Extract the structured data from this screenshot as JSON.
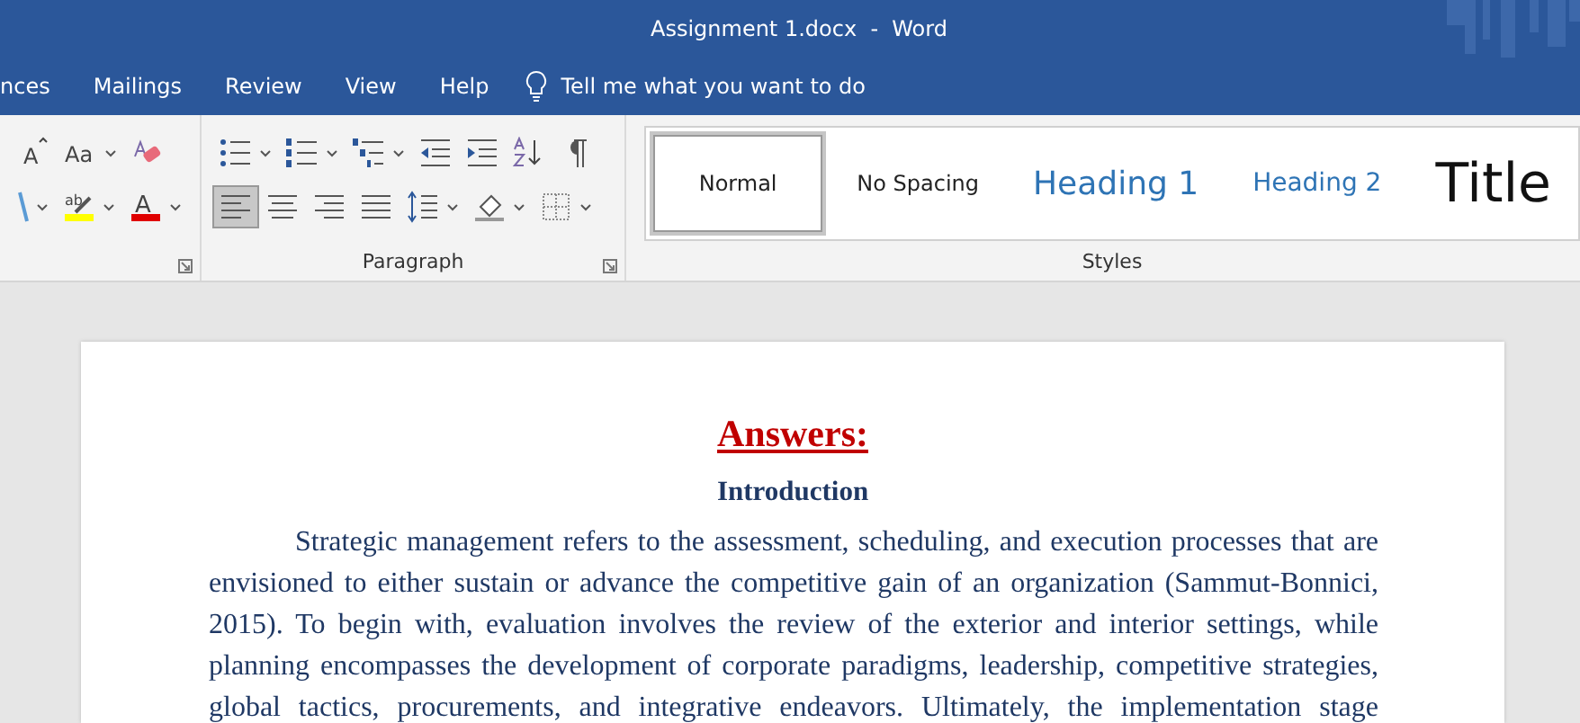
{
  "window": {
    "title": "Assignment 1.docx  -  Word"
  },
  "tabs": [
    {
      "label": "nces",
      "selected": false
    },
    {
      "label": "Mailings",
      "selected": false
    },
    {
      "label": "Review",
      "selected": false
    },
    {
      "label": "View",
      "selected": false
    },
    {
      "label": "Help",
      "selected": false
    }
  ],
  "tell_me": {
    "placeholder": "Tell me what you want to do"
  },
  "font_group": {
    "row_1": [
      {
        "kind": "grow-font",
        "glyph": "A",
        "dropdown": false
      },
      {
        "kind": "change-case",
        "glyph": "Aa",
        "dropdown": true
      },
      {
        "kind": "clear-format",
        "dropdown": false
      }
    ],
    "row_2": [
      {
        "kind": "partial",
        "dropdown": true
      },
      {
        "kind": "highlight",
        "glyph": "ab",
        "dropdown": true
      },
      {
        "kind": "font-color",
        "glyph": "A",
        "dropdown": true
      }
    ]
  },
  "paragraph_group": {
    "label": "Paragraph",
    "row_1": [
      {
        "kind": "bullets",
        "dropdown": true,
        "selected": false
      },
      {
        "kind": "numbering",
        "dropdown": true,
        "selected": false
      },
      {
        "kind": "multilevel",
        "dropdown": true,
        "selected": false
      },
      {
        "kind": "outdent",
        "dropdown": false,
        "selected": false
      },
      {
        "kind": "indent",
        "dropdown": false,
        "selected": false
      },
      {
        "kind": "sort",
        "dropdown": false,
        "selected": false
      },
      {
        "kind": "pilcrow",
        "dropdown": false,
        "selected": false
      }
    ],
    "row_2": [
      {
        "kind": "align-left",
        "dropdown": false,
        "selected": true
      },
      {
        "kind": "align-center",
        "dropdown": false,
        "selected": false
      },
      {
        "kind": "align-right",
        "dropdown": false,
        "selected": false
      },
      {
        "kind": "justify",
        "dropdown": false,
        "selected": false
      },
      {
        "kind": "line-spacing",
        "dropdown": true,
        "selected": false
      },
      {
        "kind": "shading",
        "dropdown": true,
        "selected": false
      },
      {
        "kind": "borders",
        "dropdown": true,
        "selected": false
      }
    ]
  },
  "styles_group": {
    "label": "Styles",
    "items": [
      {
        "label": "Normal",
        "kind": "normal",
        "selected": true
      },
      {
        "label": "No Spacing",
        "kind": "normal",
        "selected": false
      },
      {
        "label": "Heading 1",
        "kind": "heading1",
        "selected": false
      },
      {
        "label": "Heading 2",
        "kind": "heading2",
        "selected": false
      },
      {
        "label": "Title",
        "kind": "title",
        "selected": false
      }
    ]
  },
  "document": {
    "heading": "Answers:",
    "subheading": "Introduction",
    "paragraph": "Strategic management refers to the assessment, scheduling, and execution processes that are envisioned to either sustain or advance the competitive gain of an organization (Sammut-Bonnici, 2015). To begin with, evaluation involves the review of the exterior and interior settings, while planning encompasses the development of corporate paradigms, leadership, competitive strategies, global tactics, procurements, and integrative endeavors. Ultimately, the implementation stage"
  }
}
